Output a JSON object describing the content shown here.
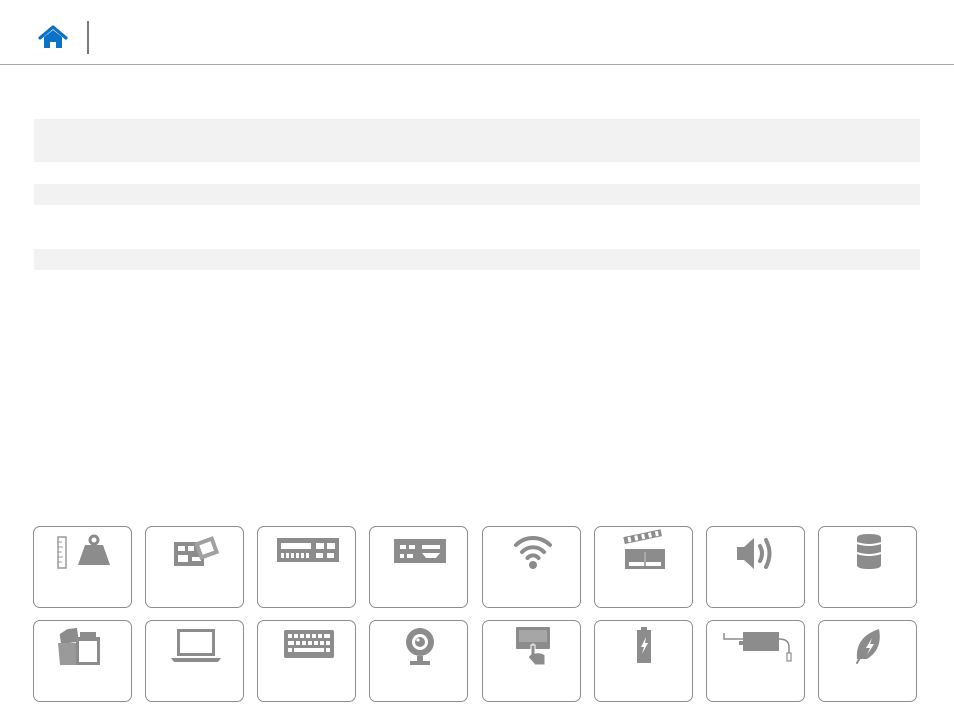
{
  "header": {
    "home_icon": "home-icon"
  },
  "colors": {
    "home_blue": "#0a72c9",
    "icon_gray": "#8c8c8c",
    "tile_border": "#8e8e8e",
    "band_gray": "#f2f2f2"
  },
  "tiles_row1": [
    {
      "icon": "dimensions-weight-icon"
    },
    {
      "icon": "system-information-icon"
    },
    {
      "icon": "ports-connectors-icon"
    },
    {
      "icon": "communications-icon"
    },
    {
      "icon": "wireless-icon"
    },
    {
      "icon": "video-icon"
    },
    {
      "icon": "audio-icon"
    },
    {
      "icon": "storage-icon"
    }
  ],
  "tiles_row2": [
    {
      "icon": "media-card-reader-icon"
    },
    {
      "icon": "display-icon"
    },
    {
      "icon": "keyboard-icon"
    },
    {
      "icon": "camera-icon"
    },
    {
      "icon": "touchpad-icon"
    },
    {
      "icon": "battery-icon"
    },
    {
      "icon": "power-adapter-icon"
    },
    {
      "icon": "environmental-icon"
    }
  ]
}
